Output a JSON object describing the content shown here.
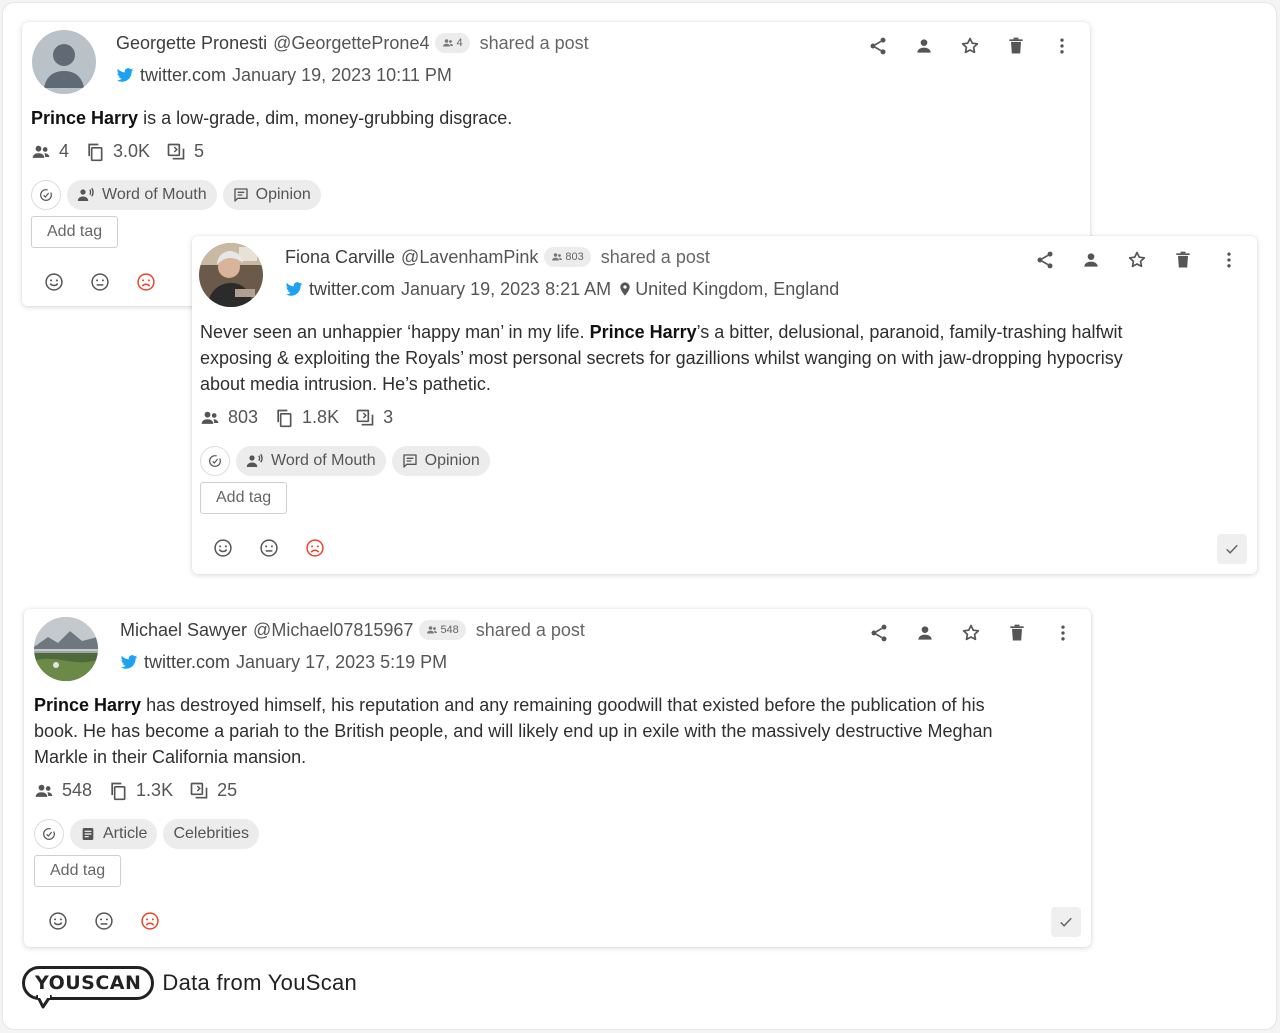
{
  "posts": [
    {
      "author": "Georgette Pronesti",
      "handle": "@GeorgetteProne4",
      "followers_badge": "4",
      "action": "shared a post",
      "source": "twitter.com",
      "date": "January 19, 2023 10:11 PM",
      "location": "",
      "text_bold": "Prince Harry",
      "text_rest": " is a low-grade, dim, money-grubbing disgrace.",
      "stats": {
        "audience": "4",
        "engagement": "3.0K",
        "reposts": "5"
      },
      "chips": [
        {
          "icon": "word-of-mouth-icon",
          "label": "Word of Mouth"
        },
        {
          "icon": "opinion-icon",
          "label": "Opinion"
        }
      ],
      "add_tag": "Add tag",
      "avatar": "default-avatar"
    },
    {
      "author": "Fiona Carville",
      "handle": "@LavenhamPink",
      "followers_badge": "803",
      "action": "shared a post",
      "source": "twitter.com",
      "date": "January 19, 2023 8:21 AM",
      "location": "United Kingdom, England",
      "text_before": "Never seen an unhappier ‘happy man’ in my life. ",
      "text_bold": "Prince Harry",
      "text_after_line1": "’s a bitter, delusional, paranoid, family-trashing halfwit",
      "text_line2": "exposing & exploiting the Royals’ most personal secrets for gazillions whilst wanging on with jaw-dropping hypocrisy",
      "text_line3": "about media intrusion. He’s pathetic.",
      "stats": {
        "audience": "803",
        "engagement": "1.8K",
        "reposts": "3"
      },
      "chips": [
        {
          "icon": "word-of-mouth-icon",
          "label": "Word of Mouth"
        },
        {
          "icon": "opinion-icon",
          "label": "Opinion"
        }
      ],
      "add_tag": "Add tag",
      "avatar": "photo-avatar"
    },
    {
      "author": "Michael Sawyer",
      "handle": "@Michael07815967",
      "followers_badge": "548",
      "action": "shared a post",
      "source": "twitter.com",
      "date": "January 17, 2023 5:19 PM",
      "location": "",
      "text_bold": "Prince Harry",
      "text_after_line1": " has destroyed himself, his reputation and any remaining goodwill that existed before the publication of his",
      "text_line2": "book. He has become a pariah to the British people, and will likely end up in exile with the massively destructive Meghan",
      "text_line3": "Markle in their California mansion.",
      "stats": {
        "audience": "548",
        "engagement": "1.3K",
        "reposts": "25"
      },
      "chips": [
        {
          "icon": "article-icon",
          "label": "Article"
        },
        {
          "icon": "",
          "label": "Celebrities"
        }
      ],
      "add_tag": "Add tag",
      "avatar": "landscape-avatar"
    }
  ],
  "footer": {
    "logo": "YOUSCAN",
    "text": "Data from YouScan"
  },
  "colors": {
    "twitter": "#1da1f2",
    "negative": "#e8452c",
    "icon": "#555555",
    "chip_bg": "#ececec"
  }
}
